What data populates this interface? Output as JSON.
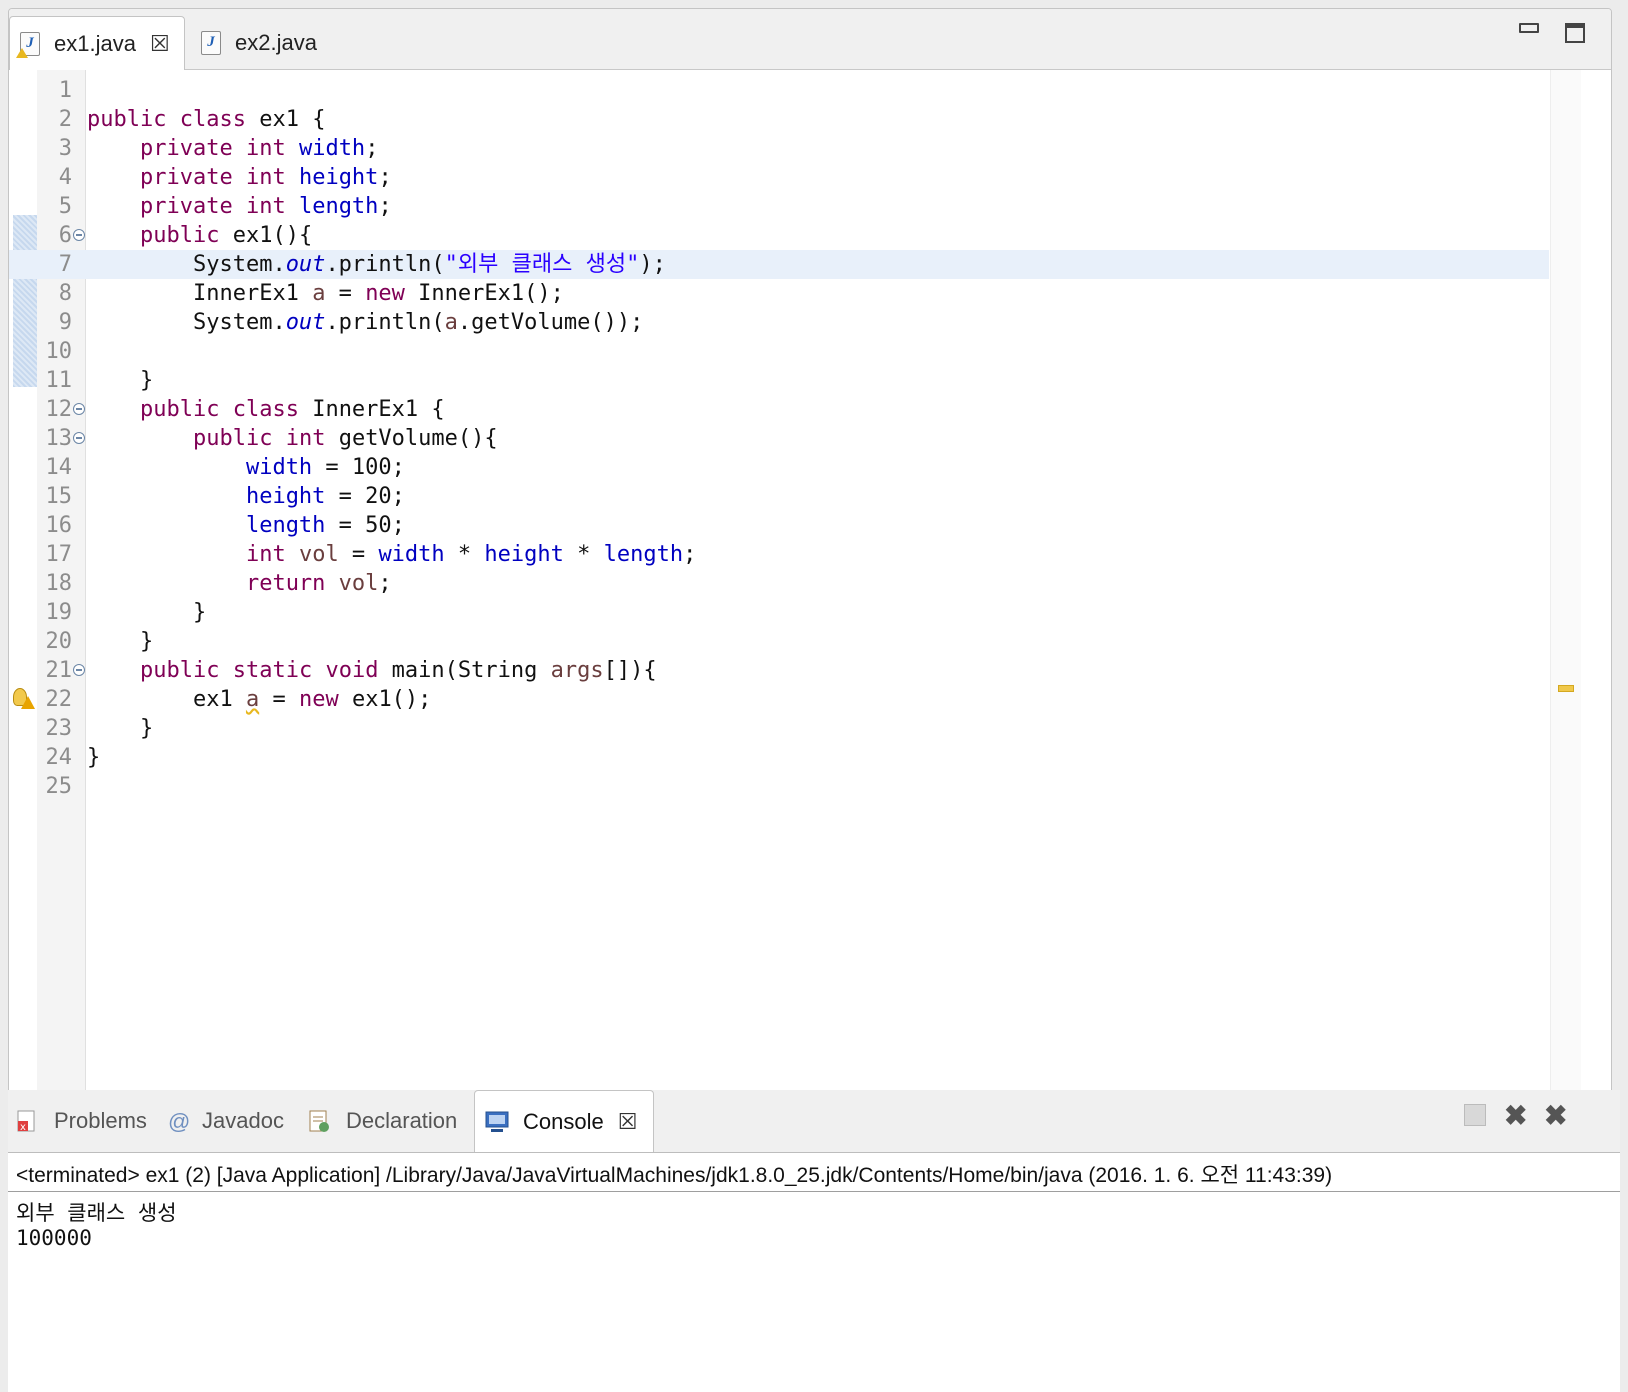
{
  "editor": {
    "tabs": [
      {
        "label": "ex1.java",
        "icon": "java-file-warning-icon",
        "active": true,
        "closable": true
      },
      {
        "label": "ex2.java",
        "icon": "java-file-icon",
        "active": false
      }
    ],
    "window_controls": [
      "minimize-icon",
      "maximize-icon"
    ],
    "current_line": 7,
    "lines": [
      {
        "n": "1"
      },
      {
        "n": "2"
      },
      {
        "n": "3"
      },
      {
        "n": "4"
      },
      {
        "n": "5"
      },
      {
        "n": "6"
      },
      {
        "n": "7"
      },
      {
        "n": "8"
      },
      {
        "n": "9"
      },
      {
        "n": "10"
      },
      {
        "n": "11"
      },
      {
        "n": "12"
      },
      {
        "n": "13"
      },
      {
        "n": "14"
      },
      {
        "n": "15"
      },
      {
        "n": "16"
      },
      {
        "n": "17"
      },
      {
        "n": "18"
      },
      {
        "n": "19"
      },
      {
        "n": "20"
      },
      {
        "n": "21"
      },
      {
        "n": "22"
      },
      {
        "n": "23"
      },
      {
        "n": "24"
      },
      {
        "n": "25"
      }
    ],
    "code": {
      "l2": {
        "public": "public",
        "class": "class",
        "rest": " ex1 {"
      },
      "l3": {
        "private": "private",
        "int": "int",
        "field": "width",
        "semi": ";"
      },
      "l4": {
        "private": "private",
        "int": "int",
        "field": "height",
        "semi": ";"
      },
      "l5": {
        "private": "private",
        "int": "int",
        "field": "length",
        "semi": ";"
      },
      "l6": {
        "public": "public",
        "rest": " ex1(){"
      },
      "l7": {
        "system": "System.",
        "out": "out",
        "call": ".println(",
        "str": "\"외부 클래스 생성\"",
        "end": ");"
      },
      "l8": {
        "type": "InnerEx1 ",
        "var": "a",
        "eq": " = ",
        "new": "new",
        "rest": " InnerEx1();"
      },
      "l9": {
        "system": "System.",
        "out": "out",
        "call": ".println(",
        "var": "a",
        "rest": ".getVolume());"
      },
      "l11": {
        "brace": "}"
      },
      "l12": {
        "public": "public",
        "class": "class",
        "rest": " InnerEx1 {"
      },
      "l13": {
        "public": "public",
        "int": "int",
        "rest": " getVolume(){"
      },
      "l14": {
        "field": "width",
        "rest": " = 100;"
      },
      "l15": {
        "field": "height",
        "rest": " = 20;"
      },
      "l16": {
        "field": "length",
        "rest": " = 50;"
      },
      "l17": {
        "int": "int",
        "var": " vol",
        "eq": " = ",
        "f1": "width",
        "op1": " * ",
        "f2": "height",
        "op2": " * ",
        "f3": "length",
        "semi": ";"
      },
      "l18": {
        "return": "return",
        "var": " vol",
        "semi": ";"
      },
      "l19": {
        "brace": "}"
      },
      "l20": {
        "brace": "}"
      },
      "l21": {
        "public": "public",
        "static": "static",
        "void": "void",
        "rest1": " main(String ",
        "args": "args",
        "rest2": "[]){"
      },
      "l22": {
        "type": "ex1 ",
        "var": "a",
        "eq": " = ",
        "new": "new",
        "rest": " ex1();"
      },
      "l23": {
        "brace": "}"
      },
      "l24": {
        "brace": "}"
      }
    }
  },
  "views": {
    "tabs": [
      {
        "label": "Problems",
        "icon": "problems-icon"
      },
      {
        "label": "Javadoc",
        "icon": "javadoc-at-icon"
      },
      {
        "label": "Declaration",
        "icon": "declaration-icon"
      },
      {
        "label": "Console",
        "icon": "console-icon",
        "active": true,
        "closable": true
      }
    ],
    "toolbar": [
      "terminate-icon",
      "remove-launch-icon",
      "remove-all-terminated-icon"
    ]
  },
  "console": {
    "status": "<terminated> ex1 (2) [Java Application] /Library/Java/JavaVirtualMachines/jdk1.8.0_25.jdk/Contents/Home/bin/java (2016. 1. 6. 오전 11:43:39)",
    "output": [
      "외부 클래스 생성",
      "100000"
    ]
  },
  "colors": {
    "keyword": "#7f0055",
    "field": "#0000c0",
    "string": "#2a00ff",
    "local": "#6a3e3e",
    "current_line": "#e8f0fa",
    "warning": "#e8b820"
  }
}
